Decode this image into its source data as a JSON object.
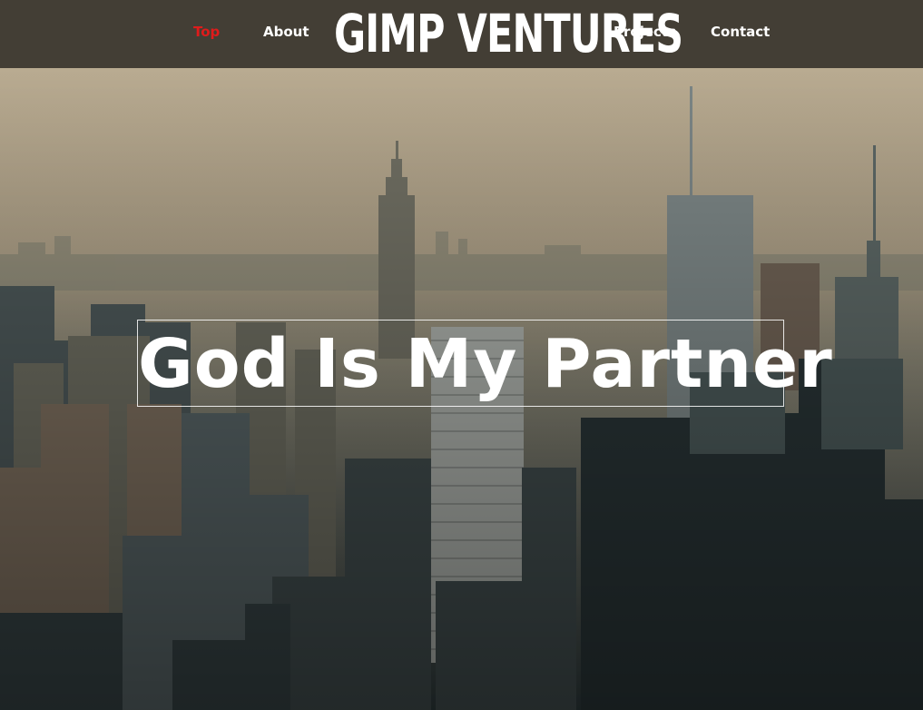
{
  "nav": {
    "items": [
      {
        "label": "Top",
        "active": true
      },
      {
        "label": "About",
        "active": false
      },
      {
        "label": "Projects",
        "active": false
      },
      {
        "label": "Contact",
        "active": false
      }
    ],
    "brand": "GIMP VENTURES",
    "active_color": "#e01b1b"
  },
  "hero": {
    "headline": "God Is My Partner",
    "background": "city-skyline-photo"
  }
}
